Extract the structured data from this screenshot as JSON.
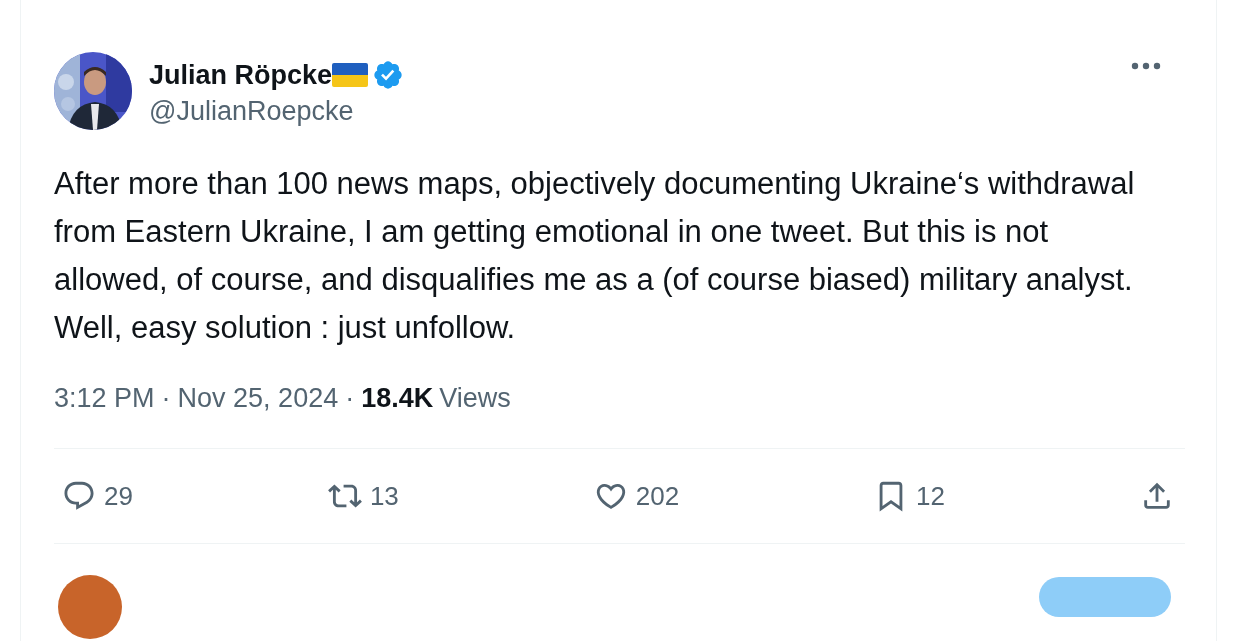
{
  "author": {
    "name": "Julian Röpcke",
    "handle": "@JulianRoepcke",
    "verified": true
  },
  "tweet": {
    "paragraphs": [
      "After more than 100 news maps, objectively documenting Ukraine‘s withdrawal from Eastern Ukraine, I am getting emotional in one tweet. But this is not allowed, of course, and disqualifies me as a (of course biased) military analyst.",
      "Well, easy solution : just unfollow."
    ]
  },
  "meta": [
    {
      "kind": "time",
      "text": "3:12 PM"
    },
    {
      "kind": "sep",
      "text": "·"
    },
    {
      "kind": "date",
      "text": "Nov 25, 2024"
    },
    {
      "kind": "sep",
      "text": "·"
    },
    {
      "kind": "count",
      "text": "18.4K"
    },
    {
      "kind": "label",
      "text": "Views"
    }
  ],
  "actions": [
    {
      "kind": "reply",
      "count": "29"
    },
    {
      "kind": "repost",
      "count": "13"
    },
    {
      "kind": "like",
      "count": "202"
    },
    {
      "kind": "bookmark",
      "count": "12"
    },
    {
      "kind": "share"
    }
  ]
}
